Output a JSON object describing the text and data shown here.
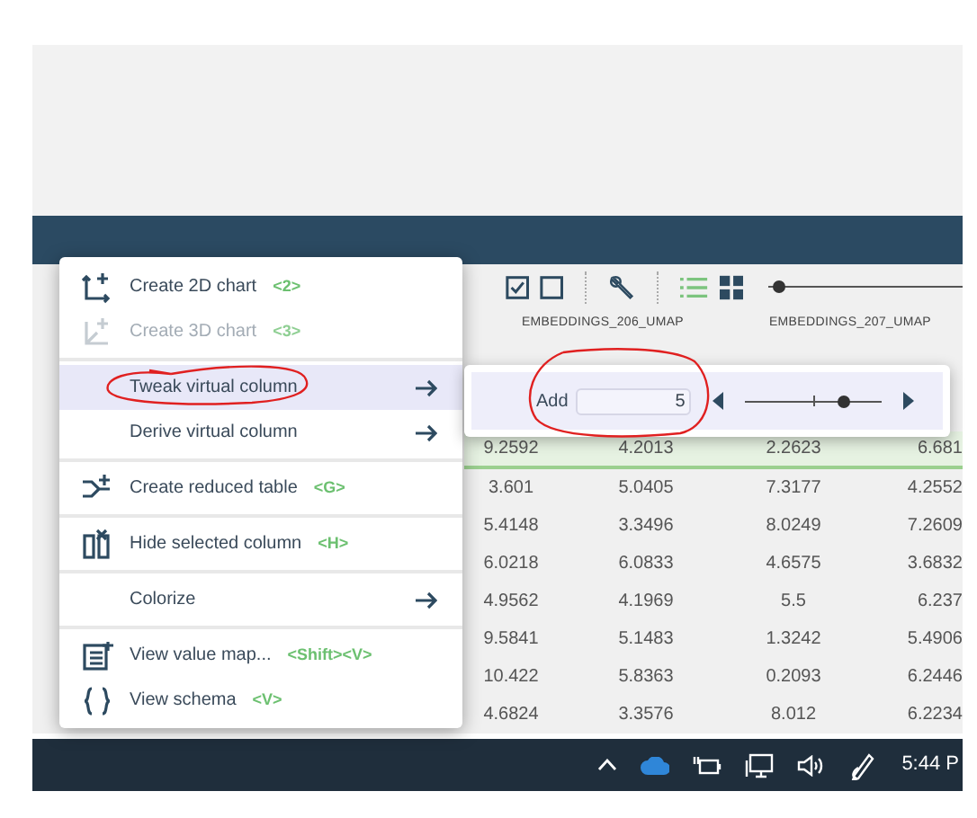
{
  "menu": {
    "groups": [
      {
        "items": [
          {
            "kind": "action",
            "label": "Create 2D chart",
            "shortcut": "<2>",
            "disabled": false,
            "highlighted": false
          },
          {
            "kind": "action",
            "label": "Create 3D chart",
            "shortcut": "<3>",
            "disabled": true,
            "highlighted": false
          }
        ]
      },
      {
        "items": [
          {
            "kind": "submenu",
            "label": "Tweak virtual column",
            "disabled": false,
            "highlighted": true
          },
          {
            "kind": "submenu",
            "label": "Derive virtual column",
            "disabled": false,
            "highlighted": false
          }
        ]
      },
      {
        "items": [
          {
            "kind": "action",
            "label": "Create reduced table",
            "shortcut": "<G>",
            "disabled": false,
            "highlighted": false
          }
        ]
      },
      {
        "items": [
          {
            "kind": "action",
            "label": "Hide selected column",
            "shortcut": "<H>",
            "disabled": false,
            "highlighted": false
          }
        ]
      },
      {
        "items": [
          {
            "kind": "submenu",
            "label": "Colorize",
            "disabled": false,
            "highlighted": false
          }
        ]
      },
      {
        "items": [
          {
            "kind": "action",
            "label": "View value map...",
            "shortcut": "<Shift><V>",
            "disabled": false,
            "highlighted": false
          },
          {
            "kind": "action",
            "label": "View schema",
            "shortcut": "<V>",
            "disabled": false,
            "highlighted": false
          }
        ]
      }
    ]
  },
  "submenu_panel": {
    "label": "Add",
    "value": "5",
    "level": 0.73
  },
  "toolbar": {
    "zoom_slider": {
      "level": 0.06
    }
  },
  "header_labels": [
    "EMBEDDINGS_206_UMAP",
    "EMBEDDINGS_207_UMAP"
  ],
  "table": {
    "rows": [
      {
        "selected": true,
        "cells": [
          "9.2592",
          "4.2013",
          "2.2623",
          "6.681"
        ]
      },
      {
        "selected": false,
        "cells": [
          "3.601",
          "5.0405",
          "7.3177",
          "4.2552"
        ]
      },
      {
        "selected": false,
        "cells": [
          "5.4148",
          "3.3496",
          "8.0249",
          "7.2609"
        ]
      },
      {
        "selected": false,
        "cells": [
          "6.0218",
          "6.0833",
          "4.6575",
          "3.6832"
        ]
      },
      {
        "selected": false,
        "cells": [
          "4.9562",
          "4.1969",
          "5.5",
          "6.237"
        ]
      },
      {
        "selected": false,
        "cells": [
          "9.5841",
          "5.1483",
          "1.3242",
          "5.4906"
        ]
      },
      {
        "selected": false,
        "cells": [
          "10.422",
          "5.8363",
          "0.2093",
          "6.2446"
        ]
      },
      {
        "selected": false,
        "cells": [
          "4.6824",
          "3.3576",
          "8.012",
          "6.2234"
        ]
      }
    ]
  },
  "taskbar": {
    "time": "5:44 P"
  }
}
